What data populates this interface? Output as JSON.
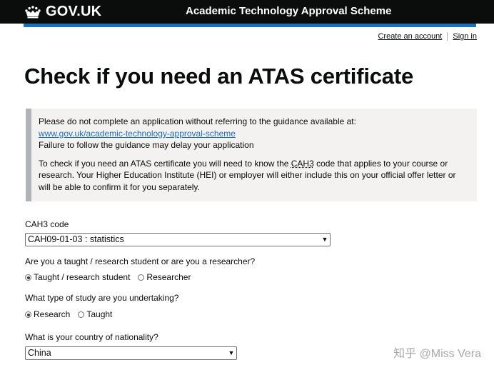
{
  "header": {
    "logo_text": "GOV.UK",
    "service_name": "Academic Technology Approval Scheme"
  },
  "account": {
    "create_label": "Create an account",
    "signin_label": "Sign in"
  },
  "page": {
    "title": "Check if you need an ATAS certificate"
  },
  "inset": {
    "line1": "Please do not complete an application without referring to the guidance available at:",
    "link_text": "www.gov.uk/academic-technology-approval-scheme",
    "line3": "Failure to follow the guidance may delay your application",
    "para2_before": "To check if you need an ATAS certificate you will need to know the ",
    "para2_abbr": "CAH3",
    "para2_after": " code that applies to your course or research. Your Higher Education Institute (HEI) or employer will either include this on your official offer letter or will be able to confirm it for you separately."
  },
  "form": {
    "cah3": {
      "label": "CAH3 code",
      "selected": "CAH09-01-03 : statistics"
    },
    "student_type": {
      "question": "Are you a taught / research student or are you a researcher?",
      "options": [
        "Taught / research student",
        "Researcher"
      ],
      "selected_index": 0
    },
    "study_type": {
      "question": "What type of study are you undertaking?",
      "options": [
        "Research",
        "Taught"
      ],
      "selected_index": 0
    },
    "nationality": {
      "label": "What is your country of nationality?",
      "selected": "China"
    }
  },
  "watermark": "知乎 @Miss Vera",
  "colors": {
    "header_bg": "#0b0c0c",
    "accent_blue": "#1d70b8",
    "inset_bg": "#f3f2f1",
    "inset_border": "#b1b4b6"
  },
  "icons": {
    "logo": "crown-icon",
    "select_arrow": "chevron-down-icon"
  }
}
